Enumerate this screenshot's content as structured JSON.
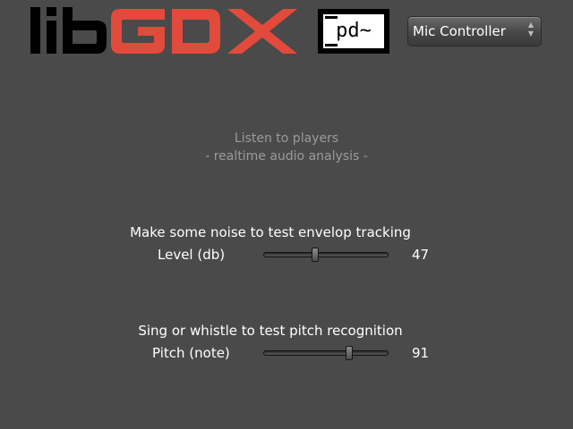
{
  "header": {
    "logo_libgdx": "libGDX",
    "logo_pd": "pd~",
    "select": {
      "value": "Mic Controller"
    }
  },
  "intro": {
    "line1": "Listen to players",
    "line2": "- realtime audio analysis -"
  },
  "level": {
    "heading": "Make some noise to test envelop tracking",
    "label": "Level (db)",
    "value": "47",
    "fraction": 0.41
  },
  "pitch": {
    "heading": "Sing or whistle to test pitch recognition",
    "label": "Pitch (note)",
    "value": "91",
    "fraction": 0.7
  },
  "colors": {
    "background": "#4a4a4a",
    "logo_lib": "#000000",
    "logo_gdx": "#e24a3b",
    "text": "#ffffff",
    "muted_text": "#9a9a9a"
  }
}
